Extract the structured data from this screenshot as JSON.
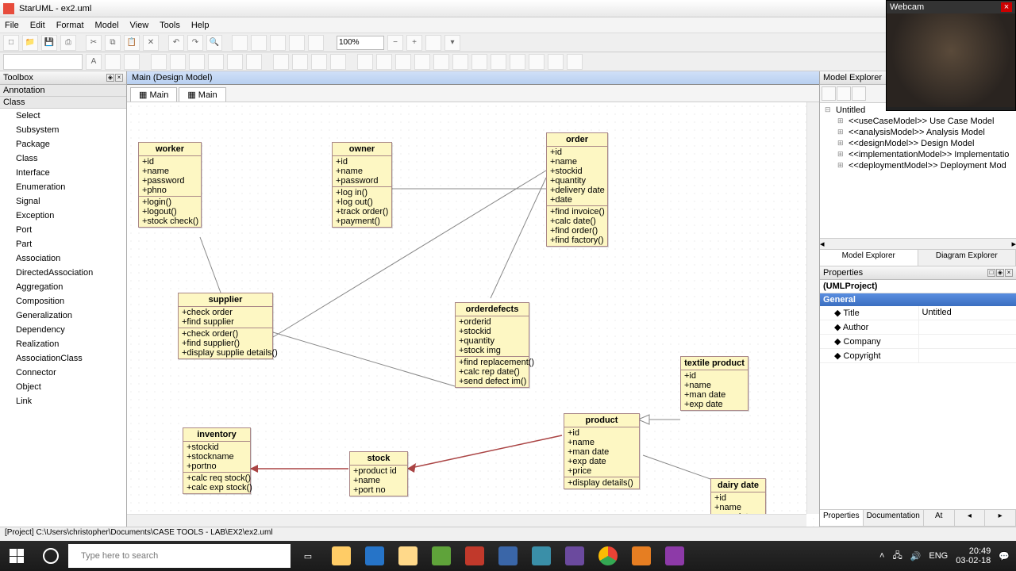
{
  "app": {
    "title": "StarUML - ex2.uml"
  },
  "menu": [
    "File",
    "Edit",
    "Format",
    "Model",
    "View",
    "Tools",
    "Help"
  ],
  "zoom": "100%",
  "canvas_header": "Main (Design Model)",
  "tabs": [
    "Main",
    "Main"
  ],
  "toolbox": {
    "title": "Toolbox",
    "groups": [
      "Annotation",
      "Class"
    ],
    "items": [
      "Select",
      "Subsystem",
      "Package",
      "Class",
      "Interface",
      "Enumeration",
      "Signal",
      "Exception",
      "Port",
      "Part",
      "Association",
      "DirectedAssociation",
      "Aggregation",
      "Composition",
      "Generalization",
      "Dependency",
      "Realization",
      "AssociationClass",
      "Connector",
      "Object",
      "Link"
    ]
  },
  "uml": {
    "worker": {
      "name": "worker",
      "attrs": [
        "+id",
        "+name",
        "+password",
        "+phno"
      ],
      "ops": [
        "+login()",
        "+logout()",
        "+stock check()"
      ]
    },
    "owner": {
      "name": "owner",
      "attrs": [
        "+id",
        "+name",
        "+password"
      ],
      "ops": [
        "+log in()",
        "+log out()",
        "+track order()",
        "+payment()"
      ]
    },
    "order": {
      "name": "order",
      "attrs": [
        "+id",
        "+name",
        "+stockid",
        "+quantity",
        "+delivery date",
        "+date"
      ],
      "ops": [
        "+find invoice()",
        "+calc date()",
        "+find order()",
        "+find factory()"
      ]
    },
    "supplier": {
      "name": "supplier",
      "attrs": [
        "+check order",
        "+find supplier"
      ],
      "ops": [
        "+check order()",
        "+find supplier()",
        "+display supplie details()"
      ]
    },
    "orderdefects": {
      "name": "orderdefects",
      "attrs": [
        "+orderid",
        "+stockid",
        "+quantity",
        "+stock img"
      ],
      "ops": [
        "+find replacement()",
        "+calc rep date()",
        "+send defect im()"
      ]
    },
    "textile": {
      "name": "textile product",
      "attrs": [
        "+id",
        "+name",
        "+man date",
        "+exp date"
      ],
      "ops": []
    },
    "inventory": {
      "name": "inventory",
      "attrs": [
        "+stockid",
        "+stockname",
        "+portno"
      ],
      "ops": [
        "+calc req stock()",
        "+calc exp stock()"
      ]
    },
    "stock": {
      "name": "stock",
      "attrs": [
        "+product id",
        "+name",
        "+port no"
      ],
      "ops": []
    },
    "product": {
      "name": "product",
      "attrs": [
        "+id",
        "+name",
        "+man date",
        "+exp date",
        "+price"
      ],
      "ops": [
        "+display details()"
      ]
    },
    "dairy": {
      "name": "dairy date",
      "attrs": [
        "+id",
        "+name",
        "+exp date"
      ],
      "ops": []
    }
  },
  "explorer": {
    "title": "Model Explorer",
    "root": "Untitled",
    "items": [
      "<<useCaseModel>> Use Case Model",
      "<<analysisModel>> Analysis Model",
      "<<designModel>> Design Model",
      "<<implementationModel>> Implementatio",
      "<<deploymentModel>> Deployment Mod"
    ],
    "tabs": [
      "Model Explorer",
      "Diagram Explorer"
    ]
  },
  "properties": {
    "title": "Properties",
    "object": "(UMLProject)",
    "group": "General",
    "rows": [
      {
        "k": "Title",
        "v": "Untitled"
      },
      {
        "k": "Author",
        "v": ""
      },
      {
        "k": "Company",
        "v": ""
      },
      {
        "k": "Copyright",
        "v": ""
      }
    ],
    "tabs": [
      "Properties",
      "Documentation",
      "At"
    ]
  },
  "status": "[Project] C:\\Users\\christopher\\Documents\\CASE TOOLS - LAB\\EX2\\ex2.uml",
  "webcam": {
    "title": "Webcam"
  },
  "taskbar": {
    "search": "Type here to search",
    "tray": {
      "lang": "ENG",
      "time": "20:49",
      "date": "03-02-18"
    }
  }
}
